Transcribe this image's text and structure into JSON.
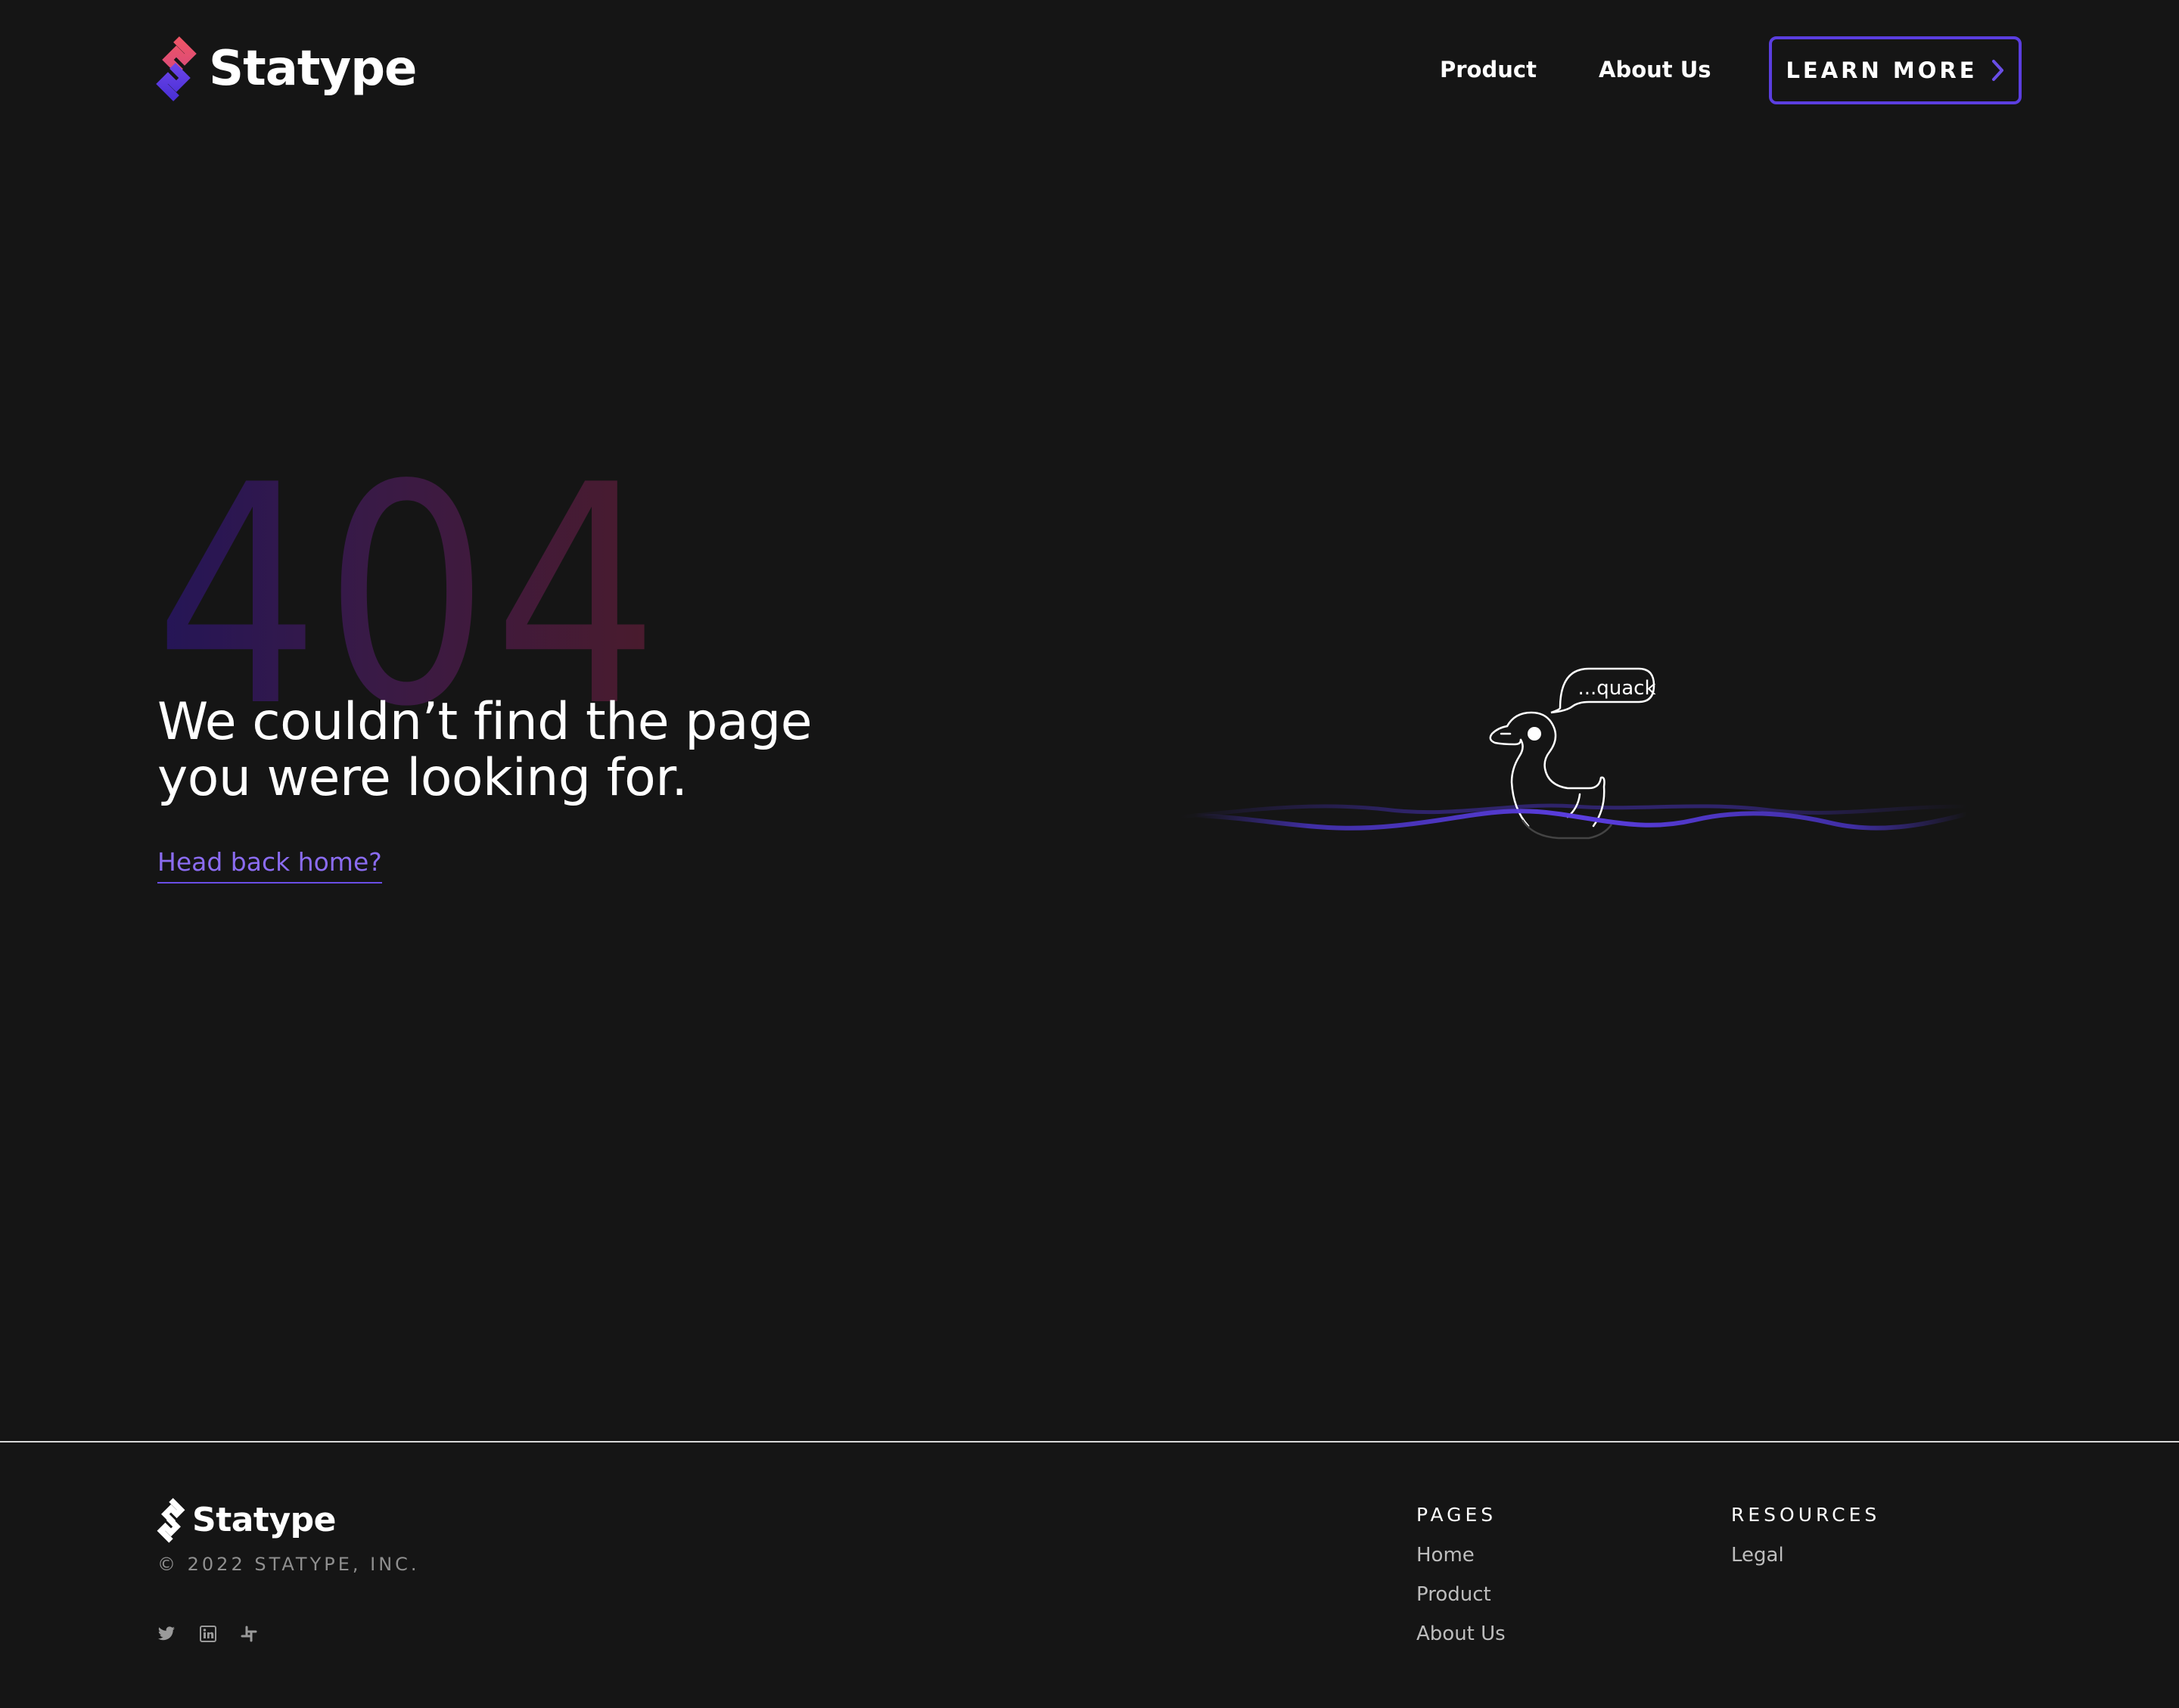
{
  "header": {
    "brand": "Statype",
    "nav": [
      {
        "label": "Product"
      },
      {
        "label": "About Us"
      }
    ],
    "cta_label": "LEARN MORE"
  },
  "hero": {
    "code": "404",
    "headline_line1": "We couldn’t find the page",
    "headline_line2": "you were looking for.",
    "home_link": "Head back home?",
    "bubble_text": "...quack"
  },
  "footer": {
    "brand": "Statype",
    "copyright": "© 2022 STATYPE, INC.",
    "social": [
      "twitter-icon",
      "linkedin-icon",
      "slack-icon"
    ],
    "pages": {
      "heading": "PAGES",
      "links": [
        "Home",
        "Product",
        "About Us"
      ]
    },
    "resources": {
      "heading": "RESOURCES",
      "links": [
        "Legal"
      ]
    }
  },
  "colors": {
    "background": "#151515",
    "accent": "#5b3ee0",
    "link": "#8b6cf1",
    "logo_top": "#e8546a",
    "logo_bottom": "#5b3ee0"
  }
}
